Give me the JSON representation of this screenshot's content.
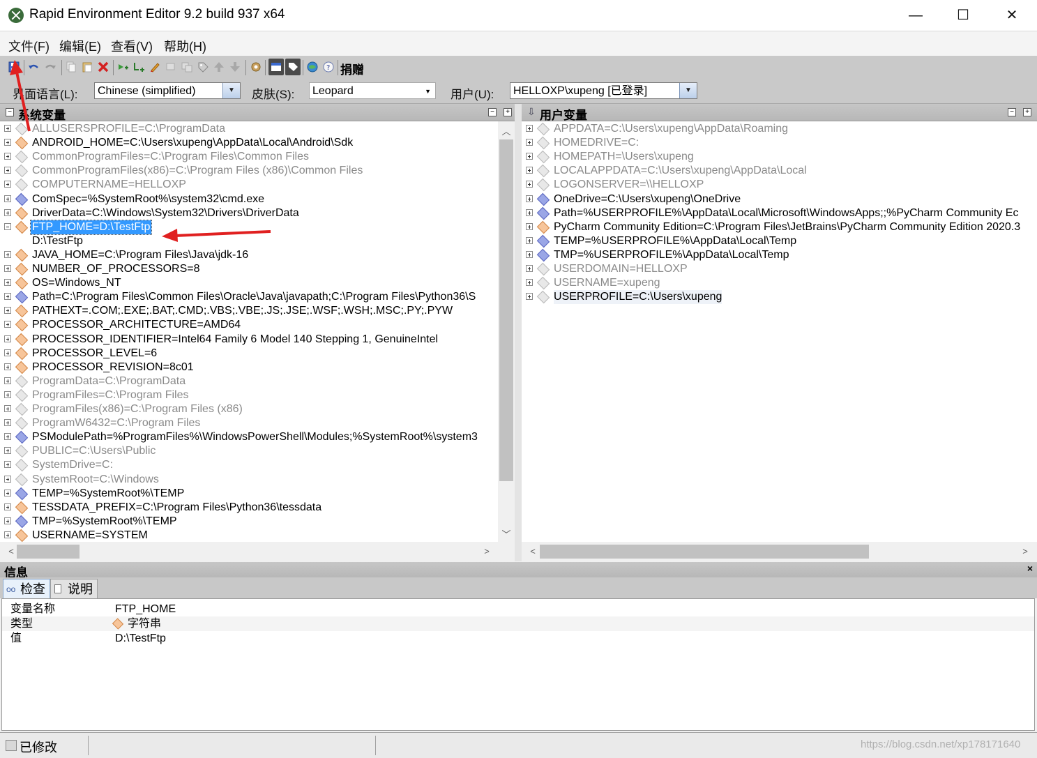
{
  "window": {
    "title": "Rapid Environment Editor 9.2 build 937 x64",
    "minimize": "—",
    "maximize": "☐",
    "close": "✕"
  },
  "menu": [
    "文件(F)",
    "编辑(E)",
    "查看(V)",
    "帮助(H)"
  ],
  "toolbar": {
    "donate_label": "捐赠"
  },
  "options": {
    "language_label": "界面语言(L):",
    "language_value": "Chinese (simplified)",
    "skin_label": "皮肤(S):",
    "skin_value": "Leopard",
    "user_label": "用户(U):",
    "user_value": "HELLOXP\\xupeng [已登录]"
  },
  "system_panel": {
    "title": "系统变量",
    "rows": [
      {
        "text": "ALLUSERSPROFILE=C:\\ProgramData",
        "style": "gray",
        "icon": "gray"
      },
      {
        "text": "ANDROID_HOME=C:\\Users\\xupeng\\AppData\\Local\\Android\\Sdk",
        "style": "black",
        "icon": "orange"
      },
      {
        "text": "CommonProgramFiles=C:\\Program Files\\Common Files",
        "style": "gray",
        "icon": "gray"
      },
      {
        "text": "CommonProgramFiles(x86)=C:\\Program Files (x86)\\Common Files",
        "style": "gray",
        "icon": "gray"
      },
      {
        "text": "COMPUTERNAME=HELLOXP",
        "style": "gray",
        "icon": "gray"
      },
      {
        "text": "ComSpec=%SystemRoot%\\system32\\cmd.exe",
        "style": "black",
        "icon": "path"
      },
      {
        "text": "DriverData=C:\\Windows\\System32\\Drivers\\DriverData",
        "style": "black",
        "icon": "orange"
      },
      {
        "text": "FTP_HOME=D:\\TestFtp",
        "style": "selected",
        "icon": "orange",
        "expanded": true
      },
      {
        "text": "D:\\TestFtp",
        "style": "child",
        "icon": "none"
      },
      {
        "text": "JAVA_HOME=C:\\Program Files\\Java\\jdk-16",
        "style": "black",
        "icon": "orange"
      },
      {
        "text": "NUMBER_OF_PROCESSORS=8",
        "style": "black",
        "icon": "orange"
      },
      {
        "text": "OS=Windows_NT",
        "style": "black",
        "icon": "orange"
      },
      {
        "text": "Path=C:\\Program Files\\Common Files\\Oracle\\Java\\javapath;C:\\Program Files\\Python36\\S",
        "style": "black",
        "icon": "path"
      },
      {
        "text": "PATHEXT=.COM;.EXE;.BAT;.CMD;.VBS;.VBE;.JS;.JSE;.WSF;.WSH;.MSC;.PY;.PYW",
        "style": "black",
        "icon": "orange"
      },
      {
        "text": "PROCESSOR_ARCHITECTURE=AMD64",
        "style": "black",
        "icon": "orange"
      },
      {
        "text": "PROCESSOR_IDENTIFIER=Intel64 Family 6 Model 140 Stepping 1, GenuineIntel",
        "style": "black",
        "icon": "orange"
      },
      {
        "text": "PROCESSOR_LEVEL=6",
        "style": "black",
        "icon": "orange"
      },
      {
        "text": "PROCESSOR_REVISION=8c01",
        "style": "black",
        "icon": "orange"
      },
      {
        "text": "ProgramData=C:\\ProgramData",
        "style": "gray",
        "icon": "gray"
      },
      {
        "text": "ProgramFiles=C:\\Program Files",
        "style": "gray",
        "icon": "gray"
      },
      {
        "text": "ProgramFiles(x86)=C:\\Program Files (x86)",
        "style": "gray",
        "icon": "gray"
      },
      {
        "text": "ProgramW6432=C:\\Program Files",
        "style": "gray",
        "icon": "gray"
      },
      {
        "text": "PSModulePath=%ProgramFiles%\\WindowsPowerShell\\Modules;%SystemRoot%\\system3",
        "style": "black",
        "icon": "path"
      },
      {
        "text": "PUBLIC=C:\\Users\\Public",
        "style": "gray",
        "icon": "gray"
      },
      {
        "text": "SystemDrive=C:",
        "style": "gray",
        "icon": "gray"
      },
      {
        "text": "SystemRoot=C:\\Windows",
        "style": "gray",
        "icon": "gray"
      },
      {
        "text": "TEMP=%SystemRoot%\\TEMP",
        "style": "black",
        "icon": "path"
      },
      {
        "text": "TESSDATA_PREFIX=C:\\Program Files\\Python36\\tessdata",
        "style": "black",
        "icon": "orange"
      },
      {
        "text": "TMP=%SystemRoot%\\TEMP",
        "style": "black",
        "icon": "path"
      },
      {
        "text": "USERNAME=SYSTEM",
        "style": "black",
        "icon": "orange"
      }
    ]
  },
  "user_panel": {
    "title": "用户变量",
    "rows": [
      {
        "text": "APPDATA=C:\\Users\\xupeng\\AppData\\Roaming",
        "style": "gray",
        "icon": "gray"
      },
      {
        "text": "HOMEDRIVE=C:",
        "style": "gray",
        "icon": "gray"
      },
      {
        "text": "HOMEPATH=\\Users\\xupeng",
        "style": "gray",
        "icon": "gray"
      },
      {
        "text": "LOCALAPPDATA=C:\\Users\\xupeng\\AppData\\Local",
        "style": "gray",
        "icon": "gray"
      },
      {
        "text": "LOGONSERVER=\\\\HELLOXP",
        "style": "gray",
        "icon": "gray"
      },
      {
        "text": "OneDrive=C:\\Users\\xupeng\\OneDrive",
        "style": "black",
        "icon": "path"
      },
      {
        "text": "Path=%USERPROFILE%\\AppData\\Local\\Microsoft\\WindowsApps;;%PyCharm Community Ec",
        "style": "black",
        "icon": "path"
      },
      {
        "text": "PyCharm Community Edition=C:\\Program Files\\JetBrains\\PyCharm Community Edition 2020.3",
        "style": "black",
        "icon": "orange"
      },
      {
        "text": "TEMP=%USERPROFILE%\\AppData\\Local\\Temp",
        "style": "black",
        "icon": "path"
      },
      {
        "text": "TMP=%USERPROFILE%\\AppData\\Local\\Temp",
        "style": "black",
        "icon": "path"
      },
      {
        "text": "USERDOMAIN=HELLOXP",
        "style": "gray",
        "icon": "gray"
      },
      {
        "text": "USERNAME=xupeng",
        "style": "gray",
        "icon": "gray"
      },
      {
        "text": "USERPROFILE=C:\\Users\\xupeng",
        "style": "hover",
        "icon": "gray"
      }
    ]
  },
  "info": {
    "title": "信息",
    "close": "×",
    "tabs": [
      "检查",
      "说明"
    ],
    "rows": [
      {
        "key": "变量名称",
        "value": "FTP_HOME"
      },
      {
        "key": "类型",
        "value": "字符串"
      },
      {
        "key": "值",
        "value": "D:\\TestFtp"
      }
    ]
  },
  "status": {
    "modified": "已修改",
    "watermark": "https://blog.csdn.net/xp178171640"
  },
  "colors": {
    "selection": "#3399ff",
    "annotation_arrow": "#e02020",
    "gray_text": "#8a8a8a"
  }
}
